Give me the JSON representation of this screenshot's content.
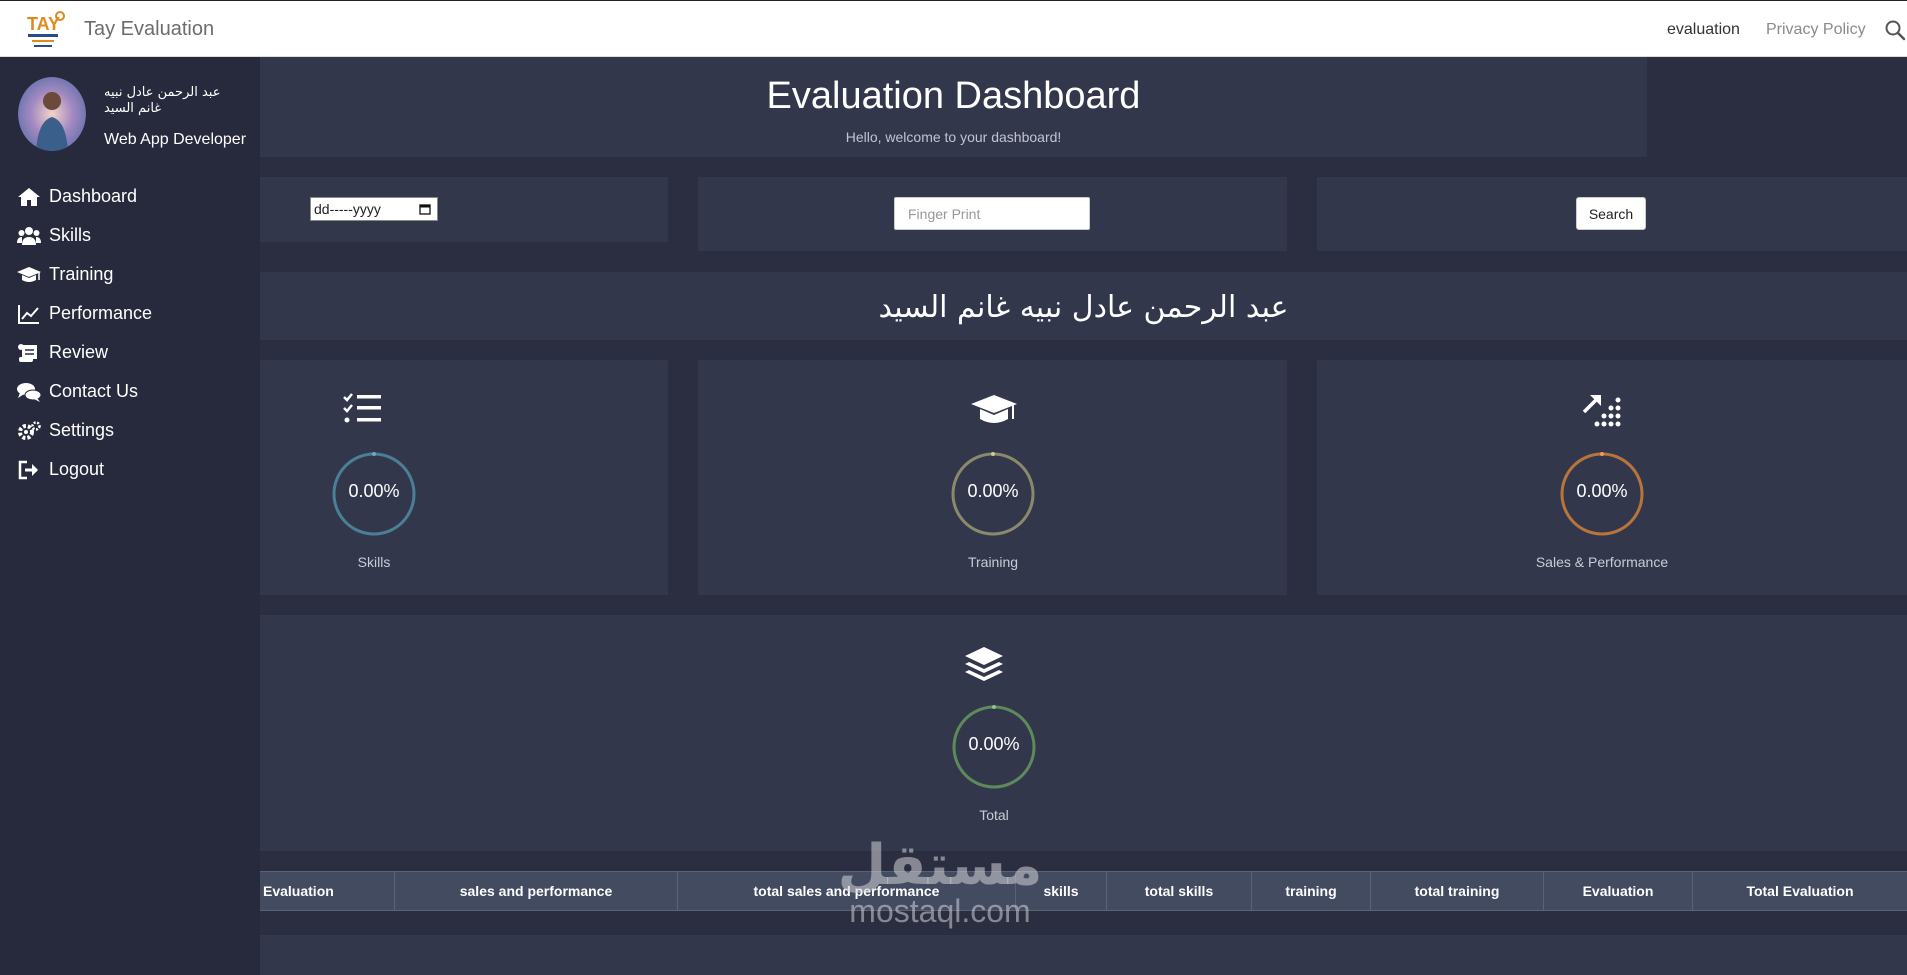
{
  "navbar": {
    "brand": "Tay Evaluation",
    "logo_text": "TAY",
    "links": [
      "evaluation",
      "Privacy Policy"
    ]
  },
  "profile": {
    "name": "عبد الرحمن عادل نبيه غانم السيد",
    "role": "Web App Developer"
  },
  "sidebar": {
    "items": [
      {
        "label": "Dashboard",
        "icon": "home-icon"
      },
      {
        "label": "Skills",
        "icon": "users-icon"
      },
      {
        "label": "Training",
        "icon": "graduation-cap-icon"
      },
      {
        "label": "Performance",
        "icon": "line-chart-icon"
      },
      {
        "label": "Review",
        "icon": "scroll-icon"
      },
      {
        "label": "Contact Us",
        "icon": "comments-icon"
      },
      {
        "label": "Settings",
        "icon": "cogs-icon"
      },
      {
        "label": "Logout",
        "icon": "logout-icon"
      }
    ]
  },
  "header": {
    "title": "Evaluation Dashboard",
    "subtitle": "Hello, welcome to your dashboard!"
  },
  "filters": {
    "date_placeholder": "dd-----yyyy",
    "fingerprint_placeholder": "Finger Print",
    "search_label": "Search"
  },
  "employee_name": "عبد الرحمن عادل نبيه غانم السيد",
  "stats": [
    {
      "label": "Skills",
      "value": "0.00%",
      "color": "#4a7f95",
      "icon": "checklist-icon"
    },
    {
      "label": "Training",
      "value": "0.00%",
      "color": "#8a8a6a",
      "icon": "graduation-cap-icon"
    },
    {
      "label": "Sales & Performance",
      "value": "0.00%",
      "color": "#b8743a",
      "icon": "growth-chart-icon"
    },
    {
      "label": "Total",
      "value": "0.00%",
      "color": "#5d8a5a",
      "icon": "layers-icon"
    }
  ],
  "table": {
    "headers": [
      "Evaluation",
      "sales and performance",
      "total sales and performance",
      "skills",
      "total skills",
      "training",
      "total training",
      "Evaluation",
      "Total Evaluation"
    ]
  },
  "watermark": {
    "arabic": "مستقل",
    "latin": "mostaql.com"
  }
}
